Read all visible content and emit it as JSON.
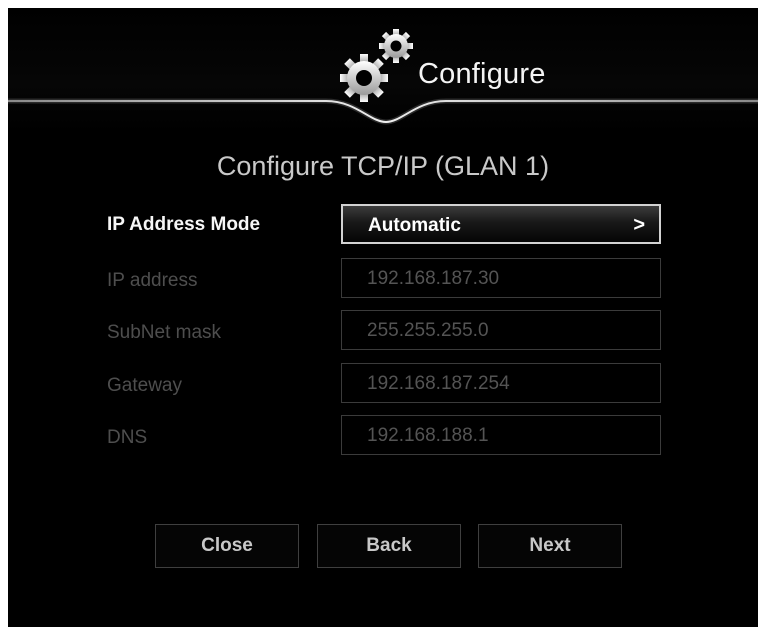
{
  "header": {
    "title": "Configure",
    "icon": "gears-icon"
  },
  "section": {
    "title": "Configure TCP/IP (GLAN 1)"
  },
  "form": {
    "ip_mode": {
      "label": "IP Address Mode",
      "value": "Automatic",
      "chevron": ">"
    },
    "ip_address": {
      "label": "IP address",
      "value": "192.168.187.30"
    },
    "subnet": {
      "label": "SubNet mask",
      "value": "255.255.255.0"
    },
    "gateway": {
      "label": "Gateway",
      "value": "192.168.187.254"
    },
    "dns": {
      "label": "DNS",
      "value": "192.168.188.1"
    }
  },
  "buttons": {
    "close": "Close",
    "back": "Back",
    "next": "Next"
  },
  "colors": {
    "background": "#000000",
    "text_active": "#ffffff",
    "text_disabled": "#545454",
    "border_active": "#d2d2d2",
    "border_inactive": "#3b3b3b"
  }
}
